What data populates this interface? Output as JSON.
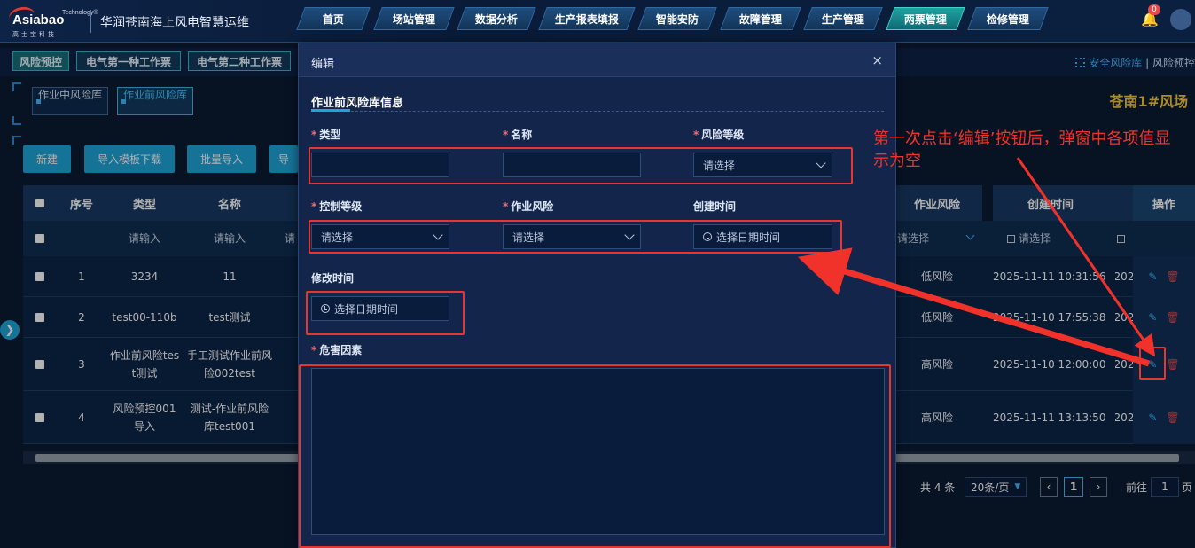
{
  "header": {
    "logo_brand": "Asiabao",
    "logo_tech": "Technology®",
    "logo_sub": "高士宝科技",
    "title": "华润苍南海上风电智慧运维",
    "nav": [
      "首页",
      "场站管理",
      "数据分析",
      "生产报表填报",
      "智能安防",
      "故障管理",
      "生产管理",
      "两票管理",
      "检修管理"
    ],
    "active_nav": "两票管理",
    "bell_count": "0"
  },
  "tabs": [
    "风险预控",
    "电气第一种工作票",
    "电气第二种工作票"
  ],
  "breadcrumb": {
    "link": "安全风险库",
    "sep": "|",
    "current": "风险预控"
  },
  "subtabs": [
    "作业中风险库",
    "作业前风险库"
  ],
  "farm_name": "苍南1#风场",
  "toolbar": {
    "new": "新建",
    "template": "导入模板下载",
    "batch": "批量导入",
    "export": "导"
  },
  "table": {
    "headers": {
      "seq": "序号",
      "type": "类型",
      "name": "名称",
      "risk": "作业风险",
      "created": "创建时间",
      "ops": "操作"
    },
    "filters": {
      "type": "请输入",
      "name": "请输入",
      "name_more": "请",
      "risk": "请选择",
      "created": "请选择"
    },
    "rows": [
      {
        "seq": "1",
        "type": "3234",
        "name": "11",
        "risk": "低风险",
        "created": "2025-11-11 10:31:56",
        "modified": "202"
      },
      {
        "seq": "2",
        "type": "test00-110b",
        "name": "test测试",
        "risk": "低风险",
        "created": "2025-11-10 17:55:38",
        "modified": "202"
      },
      {
        "seq": "3",
        "type": "作业前风险test测试",
        "name": "手工测试作业前风险002test",
        "risk": "高风险",
        "created": "2025-11-10 12:00:00",
        "modified": "202"
      },
      {
        "seq": "4",
        "type": "风险预控001导入",
        "name": "测试-作业前风险库test001",
        "risk": "高风险",
        "created": "2025-11-11 13:13:50",
        "modified": "202"
      }
    ]
  },
  "pager": {
    "total": "共 4 条",
    "size": "20条/页",
    "page": "1",
    "goto": "前往",
    "goto_val": "1",
    "page_unit": "页"
  },
  "dialog": {
    "title": "编辑",
    "close": "×",
    "section": "作业前风险库信息",
    "fields": {
      "type_label": "类型",
      "name_label": "名称",
      "risk_level_label": "风险等级",
      "control_level_label": "控制等级",
      "work_risk_label": "作业风险",
      "created_label": "创建时间",
      "modified_label": "修改时间",
      "hazard_label": "危害因素",
      "select_placeholder": "请选择",
      "date_placeholder": "选择日期时间"
    }
  },
  "annotation": "第一次点击‘编辑’按钮后，弹窗中各项值显示为空",
  "colors": {
    "accent": "#1fa5d8",
    "annotation": "#f0322a",
    "warning": "#f5c842"
  }
}
